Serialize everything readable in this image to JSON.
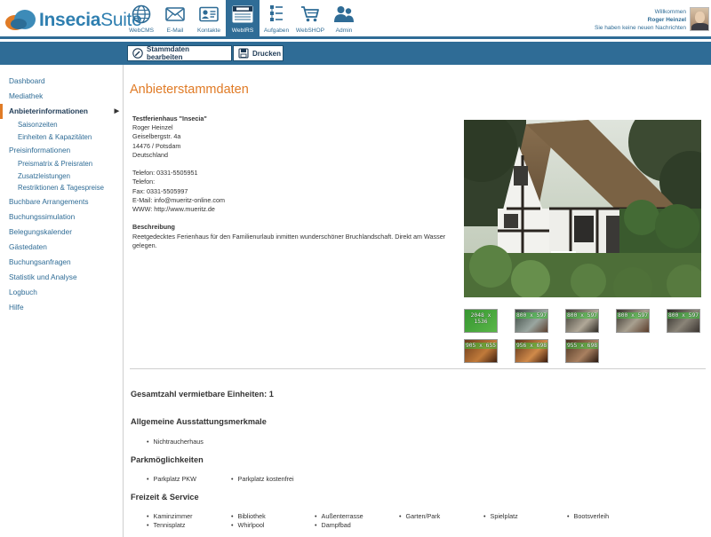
{
  "app": {
    "logo_prefix": "Insecia",
    "logo_suffix": "Suite"
  },
  "nav": [
    {
      "label": "WebCMS",
      "icon": "globe-icon"
    },
    {
      "label": "E-Mail",
      "icon": "envelope-icon"
    },
    {
      "label": "Kontakte",
      "icon": "contact-card-icon"
    },
    {
      "label": "WebIRS",
      "icon": "rooms-available-icon",
      "active": true
    },
    {
      "label": "Aufgaben",
      "icon": "task-list-icon"
    },
    {
      "label": "WebSHOP",
      "icon": "shopping-cart-icon"
    },
    {
      "label": "Admin",
      "icon": "users-icon"
    }
  ],
  "user": {
    "welcome": "Willkommen",
    "name": "Roger Heinzel",
    "messages": "Sie haben keine neuen Nachrichten"
  },
  "toolbar": {
    "edit_label": "Stammdaten bearbeiten",
    "print_label": "Drucken"
  },
  "sidebar": {
    "dashboard": "Dashboard",
    "mediathek": "Mediathek",
    "anbieter": "Anbieterinformationen",
    "saisonzeiten": "Saisonzeiten",
    "einheiten": "Einheiten & Kapazitäten",
    "preisinfo": "Preisinformationen",
    "preismatrix": "Preismatrix & Preisraten",
    "zusatz": "Zusatzleistungen",
    "restriktionen": "Restriktionen & Tagespreise",
    "arrangements": "Buchbare Arrangements",
    "simulation": "Buchungssimulation",
    "belegung": "Belegungskalender",
    "gaeste": "Gästedaten",
    "anfragen": "Buchungsanfragen",
    "statistik": "Statistik und Analyse",
    "logbuch": "Logbuch",
    "hilfe": "Hilfe"
  },
  "main": {
    "title": "Anbieterstammdaten",
    "name": "Testferienhaus \"Insecia\"",
    "contact": "Roger Heinzel",
    "street": "Geiselbergstr. 4a",
    "city": "14476 / Potsdam",
    "country": "Deutschland",
    "phone1": "Telefon: 0331-5505951",
    "phone2": "Telefon:",
    "fax": "Fax: 0331-5505997",
    "email": "E-Mail: info@mueritz-online.com",
    "www": "WWW: http://www.mueritz.de",
    "desc_label": "Beschreibung",
    "desc_text": "Reetgedecktes Ferienhaus für den Familienurlaub inmitten wunderschöner Bruchlandschaft. Direkt am Wasser gelegen.",
    "thumbs": [
      "2048 x 1536",
      "800 x 597",
      "800 x 597",
      "800 x 597",
      "800 x 597",
      "905 x 655",
      "956 x 698",
      "955 x 698"
    ],
    "units_label": "Gesamtzahl vermietbare Einheiten: 1",
    "sections": [
      {
        "title": "Allgemeine Ausstattungsmerkmale",
        "items": [
          "Nichtraucherhaus"
        ]
      },
      {
        "title": "Parkmöglichkeiten",
        "items": [
          "Parkplatz PKW",
          "Parkplatz kostenfrei"
        ]
      },
      {
        "title": "Freizeit & Service",
        "items": [
          "Kaminzimmer",
          "Bibliothek",
          "Außenterrasse",
          "Garten/Park",
          "Spielplatz",
          "Bootsverleih",
          "Tennisplatz",
          "Whirlpool",
          "Dampfbad"
        ]
      }
    ]
  },
  "colors": {
    "accent": "#e07b26",
    "primary": "#2f6c96"
  }
}
